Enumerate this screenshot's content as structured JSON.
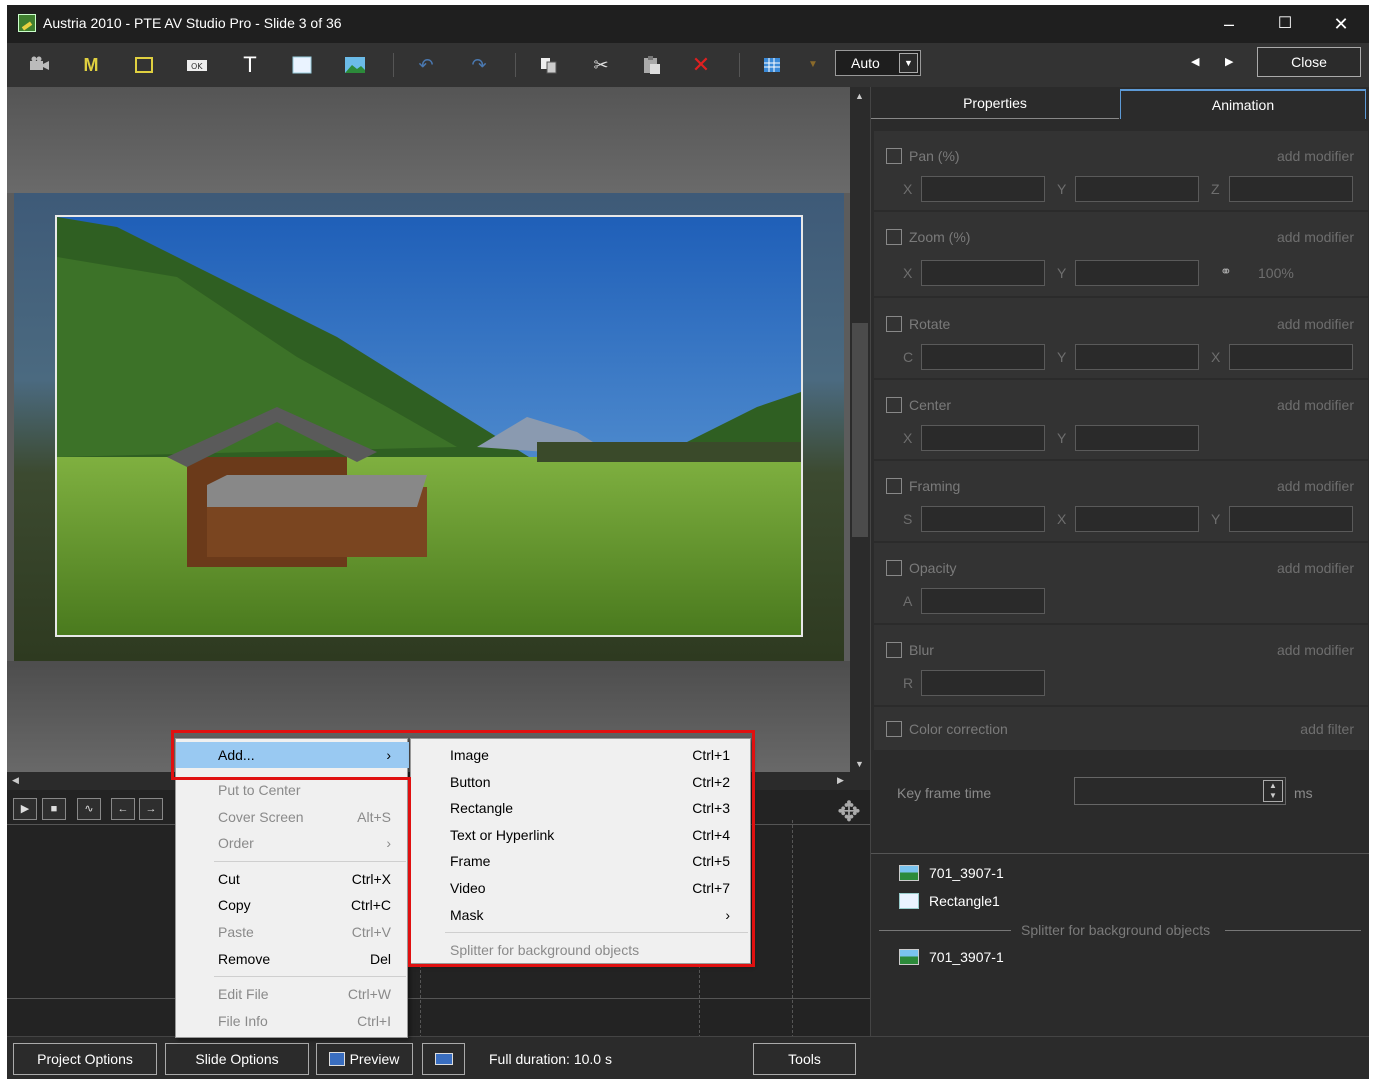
{
  "window": {
    "title": "Austria 2010 - PTE AV Studio Pro - Slide 3 of 36",
    "minimize": "–",
    "maximize": "☐",
    "close": "✕"
  },
  "toolbar": {
    "icons": [
      "camera-icon",
      "m-icon",
      "frame-icon",
      "ok-button-icon",
      "text-icon",
      "rectangle-icon",
      "image-icon",
      "undo-icon",
      "redo-icon",
      "copy-format-icon",
      "cut-icon",
      "paste-icon",
      "delete-icon",
      "grid-icon",
      "dropdown-icon"
    ],
    "m_label": "M",
    "t_label": "T",
    "ok_label": "OK",
    "zoom_select": "Auto",
    "close_label": "Close"
  },
  "right_panel": {
    "tabs": [
      "Properties",
      "Animation"
    ],
    "active_tab": "Animation",
    "sections": {
      "pan": {
        "label": "Pan (%)",
        "action": "add modifier",
        "fields": [
          "X",
          "Y",
          "Z"
        ]
      },
      "zoom": {
        "label": "Zoom (%)",
        "action": "add modifier",
        "fields": [
          "X",
          "Y"
        ],
        "value": "100%"
      },
      "rotate": {
        "label": "Rotate",
        "action": "add modifier",
        "fields": [
          "C",
          "Y",
          "X"
        ]
      },
      "center": {
        "label": "Center",
        "action": "add modifier",
        "fields": [
          "X",
          "Y"
        ]
      },
      "framing": {
        "label": "Framing",
        "action": "add modifier",
        "fields": [
          "S",
          "X",
          "Y"
        ]
      },
      "opacity": {
        "label": "Opacity",
        "action": "add modifier",
        "fields": [
          "A"
        ]
      },
      "blur": {
        "label": "Blur",
        "action": "add modifier",
        "fields": [
          "R"
        ]
      },
      "color": {
        "label": "Color correction",
        "action": "add filter"
      }
    },
    "keyframe": {
      "label": "Key frame time",
      "unit": "ms"
    },
    "objects": {
      "items": [
        "701_3907-1",
        "Rectangle1"
      ],
      "splitter": "Splitter for background objects",
      "background_items": [
        "701_3907-1"
      ]
    }
  },
  "context_menu": {
    "add": "Add...",
    "put_to_center": "Put to Center",
    "cover_screen": "Cover Screen",
    "cover_screen_shortcut": "Alt+S",
    "order": "Order",
    "cut": "Cut",
    "cut_shortcut": "Ctrl+X",
    "copy": "Copy",
    "copy_shortcut": "Ctrl+C",
    "paste": "Paste",
    "paste_shortcut": "Ctrl+V",
    "remove": "Remove",
    "remove_shortcut": "Del",
    "edit_file": "Edit File",
    "edit_file_shortcut": "Ctrl+W",
    "file_info": "File Info",
    "file_info_shortcut": "Ctrl+I"
  },
  "submenu": {
    "image": "Image",
    "image_shortcut": "Ctrl+1",
    "button": "Button",
    "button_shortcut": "Ctrl+2",
    "rectangle": "Rectangle",
    "rectangle_shortcut": "Ctrl+3",
    "text": "Text or Hyperlink",
    "text_shortcut": "Ctrl+4",
    "frame": "Frame",
    "frame_shortcut": "Ctrl+5",
    "video": "Video",
    "video_shortcut": "Ctrl+7",
    "mask": "Mask",
    "splitter": "Splitter for background objects"
  },
  "bottom_bar": {
    "project_options": "Project Options",
    "slide_options": "Slide Options",
    "preview": "Preview",
    "duration": "Full duration: 10.0 s",
    "tools": "Tools"
  },
  "colors": {
    "highlight_border": "#e01010",
    "menu_highlight": "#99c9f2",
    "tab_accent": "#5d9ad6"
  }
}
